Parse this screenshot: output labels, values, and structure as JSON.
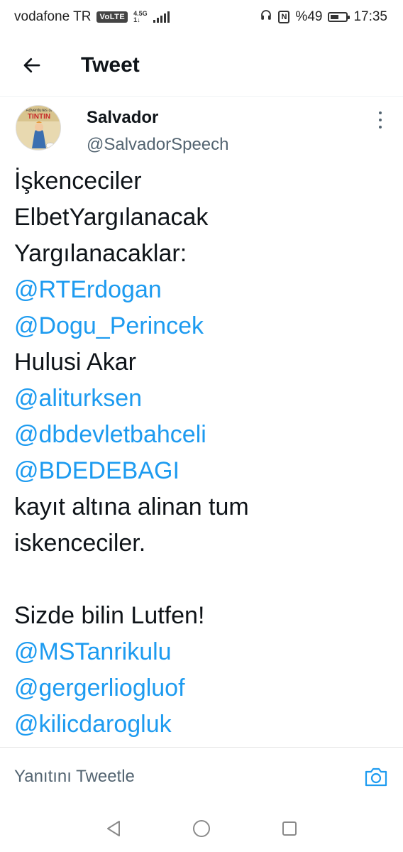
{
  "status_bar": {
    "carrier": "vodafone TR",
    "volte": "VoLTE",
    "network_type": "4.5G",
    "network_sub": "1↓",
    "battery_percent": "%49",
    "time": "17:35",
    "icons": [
      "headphones-icon",
      "nfc-icon",
      "battery-icon",
      "signal-icon"
    ]
  },
  "header": {
    "back_icon": "arrow-left-icon",
    "title": "Tweet"
  },
  "tweet": {
    "author_name": "Salvador",
    "author_handle": "@SalvadorSpeech",
    "avatar_text": "TINTIN",
    "avatar_caption": "Adventures of",
    "lines": [
      {
        "text": "İşkenceciler",
        "type": "text"
      },
      {
        "text": "ElbetYargılanacak",
        "type": "text"
      },
      {
        "text": "Yargılanacaklar:",
        "type": "text"
      },
      {
        "text": "@RTErdogan",
        "type": "mention"
      },
      {
        "text": "@Dogu_Perincek",
        "type": "mention"
      },
      {
        "text": "Hulusi Akar",
        "type": "text"
      },
      {
        "text": "@aliturksen",
        "type": "mention"
      },
      {
        "text": "@dbdevletbahceli",
        "type": "mention"
      },
      {
        "text": "@BDEDEBAGI",
        "type": "mention"
      },
      {
        "text": "kayıt altına alinan tum",
        "type": "text"
      },
      {
        "text": "iskenceciler.",
        "type": "text"
      },
      {
        "text": "",
        "type": "blank"
      },
      {
        "text": "Sizde bilin Lutfen!",
        "type": "text"
      },
      {
        "text": "@MSTanrikulu",
        "type": "mention"
      },
      {
        "text": "@gergerliogluof",
        "type": "mention"
      },
      {
        "text": "@kilicdarogluk",
        "type": "mention"
      }
    ]
  },
  "reply_bar": {
    "placeholder": "Yanıtını Tweetle",
    "camera_icon": "camera-icon"
  },
  "navbar": {
    "buttons": [
      "back-triangle-icon",
      "home-circle-icon",
      "recents-square-icon"
    ]
  },
  "colors": {
    "link": "#1d9bf0",
    "text": "#0f1419",
    "secondary": "#536471"
  }
}
